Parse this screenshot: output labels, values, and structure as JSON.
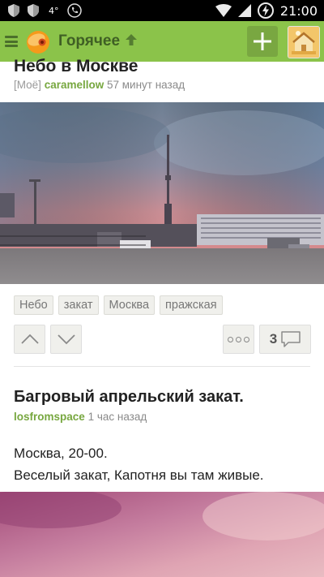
{
  "status_bar": {
    "temperature": "4°",
    "time": "21:00"
  },
  "app_bar": {
    "title": "Горячее",
    "icons": [
      "menu-icon",
      "app-logo",
      "arrow-up-icon",
      "plus-icon",
      "user-avatar"
    ]
  },
  "post1": {
    "title": "Небо в Москве",
    "mine_tag": "[Моё]",
    "author": "caramellow",
    "time_ago": "57 минут назад",
    "tags": [
      "Небо",
      "закат",
      "Москва",
      "пражская"
    ],
    "comments_count": "3"
  },
  "post2": {
    "title": "Багровый апрельский закат.",
    "author": "losfromspace",
    "time_ago": "1 час назад",
    "body_lines": [
      "Москва, 20-00.",
      "Веселый закат, Капотня вы там живые."
    ]
  },
  "colors": {
    "app_bar": "#8bc34a",
    "author": "#77a73f",
    "status_bar": "#000000"
  }
}
